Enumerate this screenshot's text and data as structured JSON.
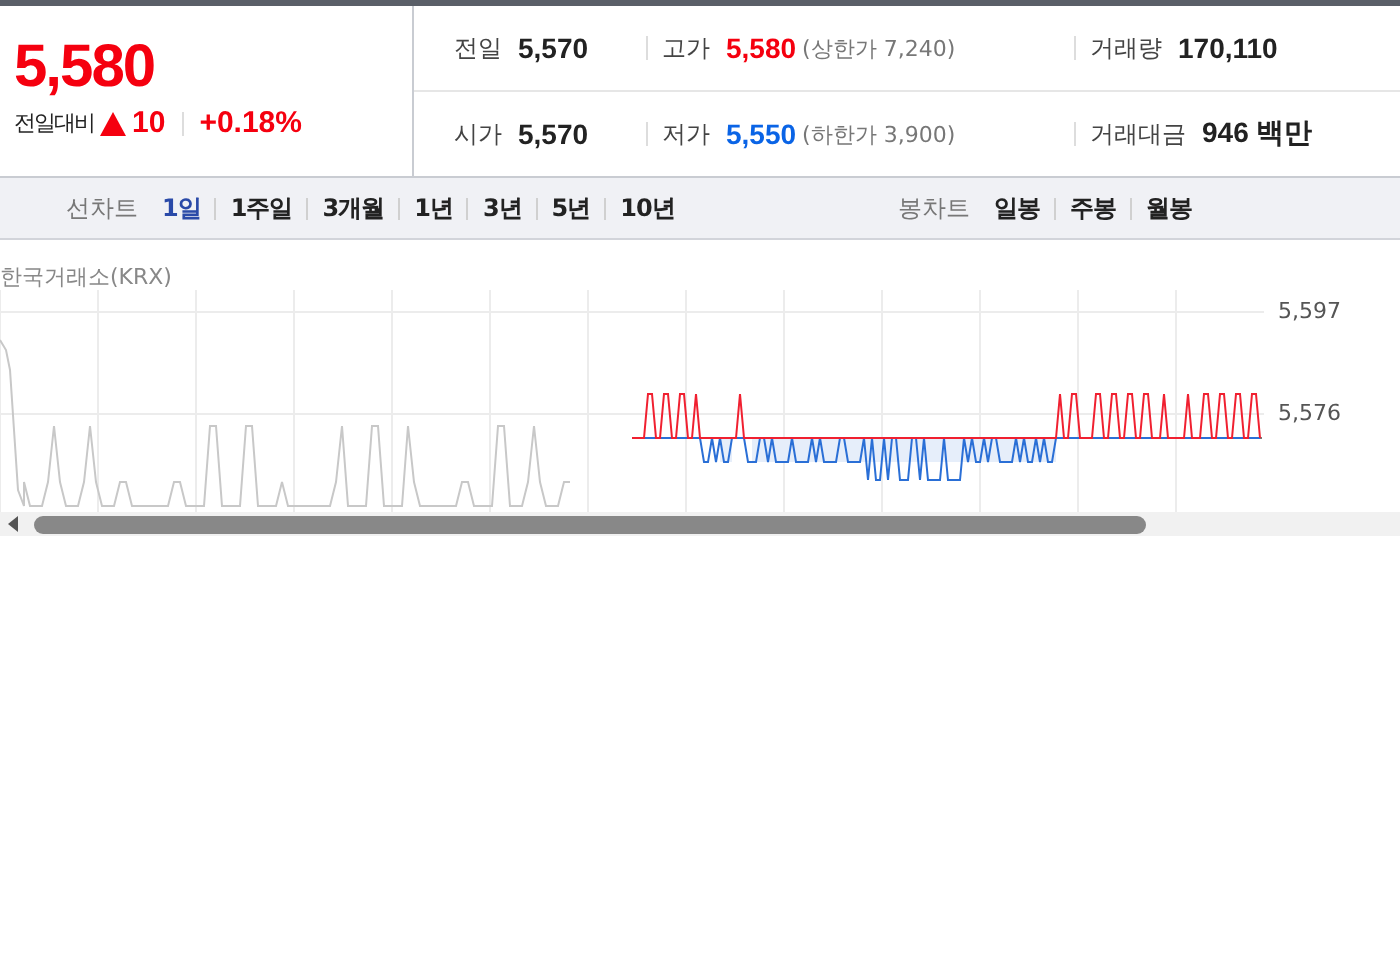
{
  "quote": {
    "price": "5,580",
    "change_label": "전일대비",
    "rising": true,
    "color": "#f5000f",
    "change": "10",
    "change_rate": "+0.18%"
  },
  "stats": [
    {
      "label": "전일",
      "value": "5,570",
      "color": "#222222"
    },
    {
      "label": "고가",
      "value": "5,580",
      "color": "#f5000f",
      "note": "(상한가 7,240)"
    },
    {
      "label": "거래량",
      "value": "170,110",
      "color": "#222222"
    },
    {
      "label": "시가",
      "value": "5,570",
      "color": "#222222"
    },
    {
      "label": "저가",
      "value": "5,550",
      "color": "#0a64e6",
      "note": "(하한가 3,900)"
    },
    {
      "label": "거래대금",
      "value": "946 백만",
      "color": "#222222"
    }
  ],
  "line_chart_tabs": {
    "label": "선차트",
    "items": [
      {
        "label": "1일",
        "selected": true
      },
      {
        "label": "1주일",
        "selected": false
      },
      {
        "label": "3개월",
        "selected": false
      },
      {
        "label": "1년",
        "selected": false
      },
      {
        "label": "3년",
        "selected": false
      },
      {
        "label": "5년",
        "selected": false
      },
      {
        "label": "10년",
        "selected": false
      }
    ]
  },
  "candle_chart_tabs": {
    "label": "봉차트",
    "items": [
      {
        "label": "일봉",
        "selected": false
      },
      {
        "label": "주봉",
        "selected": false
      },
      {
        "label": "월봉",
        "selected": false
      }
    ]
  },
  "chart": {
    "source": "한국거래소(KRX)",
    "y_ticks": [
      "5,597",
      "5,576"
    ]
  }
}
